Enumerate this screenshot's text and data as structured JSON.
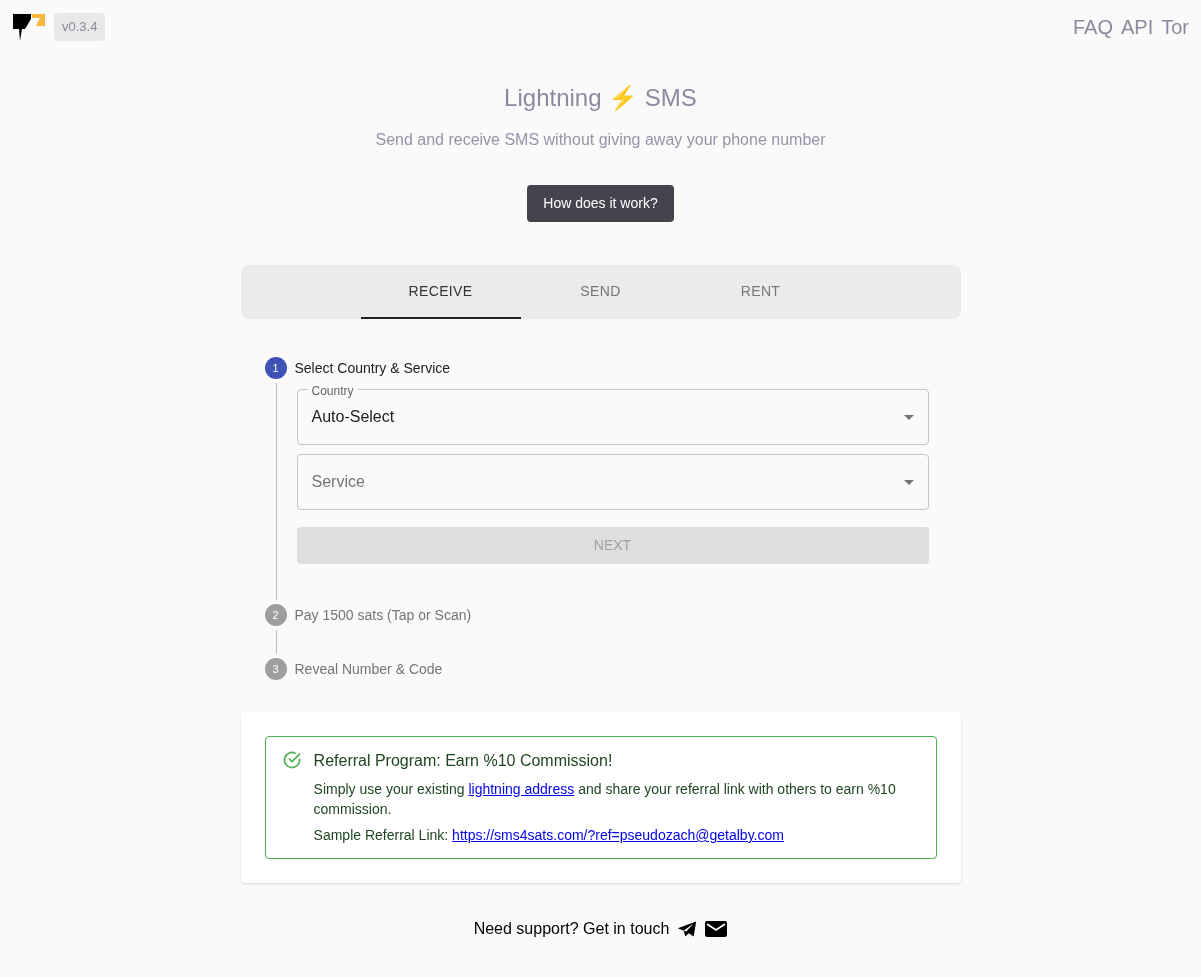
{
  "header": {
    "version": "v0.3.4",
    "nav": [
      "FAQ",
      "API",
      "Tor"
    ]
  },
  "hero": {
    "title": "Lightning ⚡ SMS",
    "subtitle": "Send and receive SMS without giving away your phone number",
    "button": "How does it work?"
  },
  "tabs": [
    {
      "label": "RECEIVE",
      "selected": true
    },
    {
      "label": "SEND",
      "selected": false
    },
    {
      "label": "RENT",
      "selected": false
    }
  ],
  "steps": [
    {
      "number": "1",
      "label": "Select Country & Service",
      "active": true
    },
    {
      "number": "2",
      "label": "Pay 1500 sats (Tap or Scan)",
      "active": false
    },
    {
      "number": "3",
      "label": "Reveal Number & Code",
      "active": false
    }
  ],
  "form": {
    "country": {
      "label": "Country",
      "value": "Auto-Select"
    },
    "service": {
      "placeholder": "Service"
    },
    "next": {
      "label": "NEXT",
      "disabled": true
    }
  },
  "referral": {
    "title": "Referral Program: Earn %10 Commission!",
    "before": "Simply use your existing ",
    "link": "lightning address",
    "after": " and share your referral link with others to earn %10 commission.",
    "sample_label": "Sample Referral Link: ",
    "sample_link": "https://sms4sats.com/?ref=pseudozach@getalby.com"
  },
  "footer": {
    "text": "Need support? Get in touch"
  }
}
